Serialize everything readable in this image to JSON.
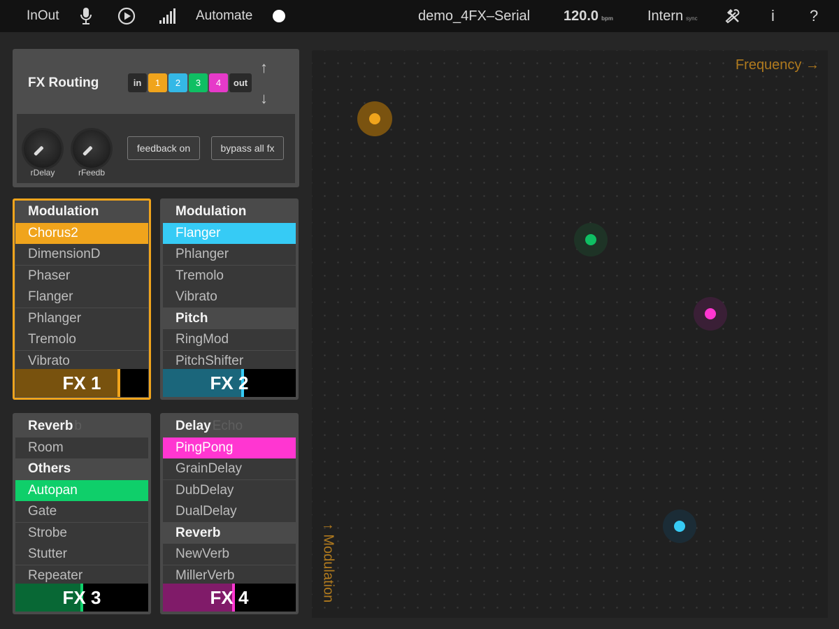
{
  "topbar": {
    "inout_label": "InOut",
    "automate_label": "Automate",
    "preset_name": "demo_4FX–Serial",
    "tempo": "120.0",
    "tempo_unit": "bpm",
    "sync_label": "Intern",
    "sync_sub": "sync",
    "info_label": "i",
    "help_label": "?",
    "icons": [
      "microphone-icon",
      "play-icon",
      "level-meter-icon",
      "record-dot-icon",
      "tools-icon"
    ]
  },
  "routing": {
    "title": "FX Routing",
    "chain": [
      {
        "label": "in",
        "color": "#2a2a2a"
      },
      {
        "label": "1",
        "color": "#f0a41c"
      },
      {
        "label": "2",
        "color": "#34b8e6"
      },
      {
        "label": "3",
        "color": "#0fbf63"
      },
      {
        "label": "4",
        "color": "#e63ac9"
      },
      {
        "label": "out",
        "color": "#2a2a2a"
      }
    ],
    "arrow_up": "↑",
    "arrow_down": "↓",
    "knobs": [
      {
        "label": "rDelay"
      },
      {
        "label": "rFeedb"
      }
    ],
    "feedback_button": "feedback on",
    "bypass_button": "bypass all fx"
  },
  "fx_slots": [
    {
      "name": "FX 1",
      "color": "#f0a41c",
      "level": 0.78,
      "selected": true,
      "rows": [
        {
          "text": "Modulation",
          "type": "head"
        },
        {
          "text": "Chorus2",
          "type": "item",
          "active": true
        },
        {
          "text": "DimensionD",
          "type": "item"
        },
        {
          "text": "Phaser",
          "type": "item"
        },
        {
          "text": "Flanger",
          "type": "item"
        },
        {
          "text": "Phlanger",
          "type": "item"
        },
        {
          "text": "Tremolo",
          "type": "item"
        },
        {
          "text": "Vibrato",
          "type": "item"
        }
      ]
    },
    {
      "name": "FX 2",
      "color": "#36cbf5",
      "level": 0.6,
      "selected": false,
      "rows": [
        {
          "text": "Modulation",
          "type": "head"
        },
        {
          "text": "Flanger",
          "type": "item",
          "active": true
        },
        {
          "text": "Phlanger",
          "type": "item"
        },
        {
          "text": "Tremolo",
          "type": "item"
        },
        {
          "text": "Vibrato",
          "type": "item"
        },
        {
          "text": "Pitch",
          "type": "head"
        },
        {
          "text": "RingMod",
          "type": "item"
        },
        {
          "text": "PitchShifter",
          "type": "item"
        }
      ]
    },
    {
      "name": "FX 3",
      "color": "#0fcf6a",
      "level": 0.5,
      "selected": false,
      "rows": [
        {
          "text": "Reverb",
          "type": "head",
          "ghost": "b"
        },
        {
          "text": "Room",
          "type": "item"
        },
        {
          "text": "Others",
          "type": "head"
        },
        {
          "text": "Autopan",
          "type": "item",
          "active": true
        },
        {
          "text": "Gate",
          "type": "item"
        },
        {
          "text": "Strobe",
          "type": "item"
        },
        {
          "text": "Stutter",
          "type": "item"
        },
        {
          "text": "Repeater",
          "type": "item"
        }
      ]
    },
    {
      "name": "FX 4",
      "color": "#ff36d1",
      "level": 0.53,
      "selected": false,
      "rows": [
        {
          "text": "Delay",
          "type": "head",
          "ghost": "Echo"
        },
        {
          "text": "PingPong",
          "type": "item",
          "active": true
        },
        {
          "text": "GrainDelay",
          "type": "item"
        },
        {
          "text": "DubDelay",
          "type": "item"
        },
        {
          "text": "DualDelay",
          "type": "item"
        },
        {
          "text": "Reverb",
          "type": "head"
        },
        {
          "text": "NewVerb",
          "type": "item"
        },
        {
          "text": "MillerVerb",
          "type": "item"
        }
      ]
    }
  ],
  "xy_pad": {
    "x_label": "Frequency →",
    "y_label": "↑ Modulation",
    "points": [
      {
        "slot": "FX 1",
        "color": "#f0a41c",
        "x": 0.122,
        "y": 0.879,
        "halo": "#7a5310"
      },
      {
        "slot": "FX 3",
        "color": "#0fbf63",
        "x": 0.54,
        "y": 0.666,
        "halo": "#1e3326"
      },
      {
        "slot": "FX 4",
        "color": "#ff36d1",
        "x": 0.772,
        "y": 0.536,
        "halo": "#3a1f36"
      },
      {
        "slot": "FX 2",
        "color": "#36cbf5",
        "x": 0.713,
        "y": 0.161,
        "halo": "#1b2c36"
      }
    ]
  }
}
